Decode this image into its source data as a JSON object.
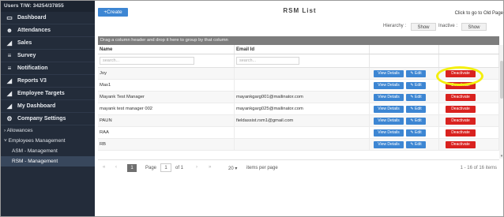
{
  "sidebar": {
    "users_label": "Users T/W: 34254/37855",
    "items": [
      {
        "icon": "monitor-icon",
        "glyph": "▭",
        "label": "Dashboard"
      },
      {
        "icon": "person-icon",
        "glyph": "👤",
        "label": "Attendances"
      },
      {
        "icon": "chart-icon",
        "glyph": "◢",
        "label": "Sales"
      },
      {
        "icon": "filter-icon",
        "glyph": "≡",
        "label": "Survey"
      },
      {
        "icon": "filter-icon",
        "glyph": "≡",
        "label": "Notification"
      },
      {
        "icon": "chart-icon",
        "glyph": "◢",
        "label": "Reports V3"
      },
      {
        "icon": "chart-icon",
        "glyph": "◢",
        "label": "Employee Targets"
      },
      {
        "icon": "chart-icon",
        "glyph": "◢",
        "label": "My Dashboard"
      },
      {
        "icon": "gears-icon",
        "glyph": "⚙",
        "label": "Company Settings"
      }
    ],
    "allowances": "Allowances",
    "employees_management": "Employees Management",
    "asm_management": "ASM - Management",
    "rsm_management": "RSM - Management"
  },
  "toolbar": {
    "create_label": "+Create",
    "title": "RSM  List",
    "old_page_link": "Click to go to Old Page",
    "hierarchy_label": "Hierarchy :",
    "hierarchy_toggle": "Show",
    "inactive_label": "Inactive :",
    "inactive_toggle": "Show"
  },
  "grid": {
    "group_hint": "Drag a column header and drop it here to group by that column",
    "columns": [
      "Name",
      "Email Id",
      "",
      ""
    ],
    "search_placeholder": "search...",
    "view_label": "View Details",
    "edit_label": "Edit",
    "deactivate_label": "Deactivate",
    "rows": [
      {
        "name": "Joy",
        "email": ""
      },
      {
        "name": "Mas1",
        "email": ""
      },
      {
        "name": "Mayank Test Manager",
        "email": "mayankgarg001@mailinator.com"
      },
      {
        "name": "mayank test manager 002",
        "email": "mayankgarg025@mailinator.com"
      },
      {
        "name": "PAUN",
        "email": "fieldassist.rsm1@gmail.com"
      },
      {
        "name": "RAA",
        "email": ""
      },
      {
        "name": "RB",
        "email": ""
      }
    ]
  },
  "pager": {
    "first": "«",
    "prev": "‹",
    "current_page": "1",
    "page_label": "Page",
    "page_input": "1",
    "of_label": "of 1",
    "next": "›",
    "last": "»",
    "page_size": "20",
    "per_page_label": "items per page",
    "info": "1 - 16 of 16 items"
  },
  "colors": {
    "sidebar_bg": "#232c3a",
    "primary_button": "#3d86d3",
    "danger_button": "#d9221f",
    "annotation_circle": "#f4ef0d"
  }
}
